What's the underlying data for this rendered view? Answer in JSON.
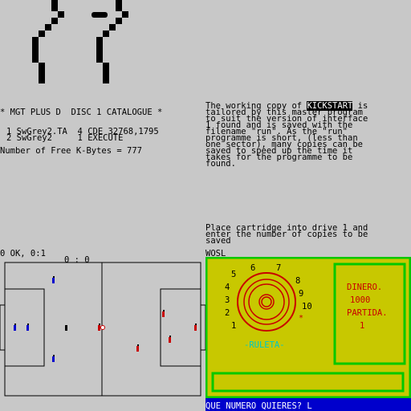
{
  "header_text": {
    "catalogue": "* MGT PLUS D  DISC 1 CATALOGUE *",
    "files": [
      {
        "num": "1",
        "name": "SwGrey2.TA",
        "num2": "4",
        "info": "CDE 32768,1795"
      },
      {
        "num": "2",
        "name": "SwGrey2",
        "num2": "1",
        "info": "EXECUTE"
      }
    ],
    "free": "Number of Free K-Bytes = 777"
  },
  "info_panel": {
    "lines": [
      "The working copy of ",
      "tailored by this master program",
      "to suit the version of interface",
      "1 found and is saved with the",
      "filename \"run\". As the \"run\"",
      "programme is short, (less than",
      "one sector), many copies can be",
      "saved to speed up the time it",
      "takes for the programme to be",
      "found."
    ],
    "highlight": "KICKSTART",
    "line1_suffix": " is",
    "place_lines": [
      "Place cartridge into drive 1 and",
      "enter the number of copies to be",
      "saved"
    ],
    "wosl": "WOSL"
  },
  "football": {
    "status": "0 OK, 0:1",
    "score": "0 : 0"
  },
  "roulette": {
    "numbers": [
      "1",
      "2",
      "3",
      "4",
      "5",
      "6",
      "7",
      "8",
      "9",
      "10"
    ],
    "label": "-RULETA-",
    "dinero_label": "DINERO.",
    "dinero_value": "1000",
    "partida_label": "PARTIDA.",
    "partida_value": "1",
    "prompt": "QUE NUMERO QUIERES? L",
    "colors": {
      "bg": "#c8c800",
      "border": "#00c800",
      "red": "#c80000",
      "cyan": "#00c8c8",
      "blue": "#0000cc"
    }
  }
}
